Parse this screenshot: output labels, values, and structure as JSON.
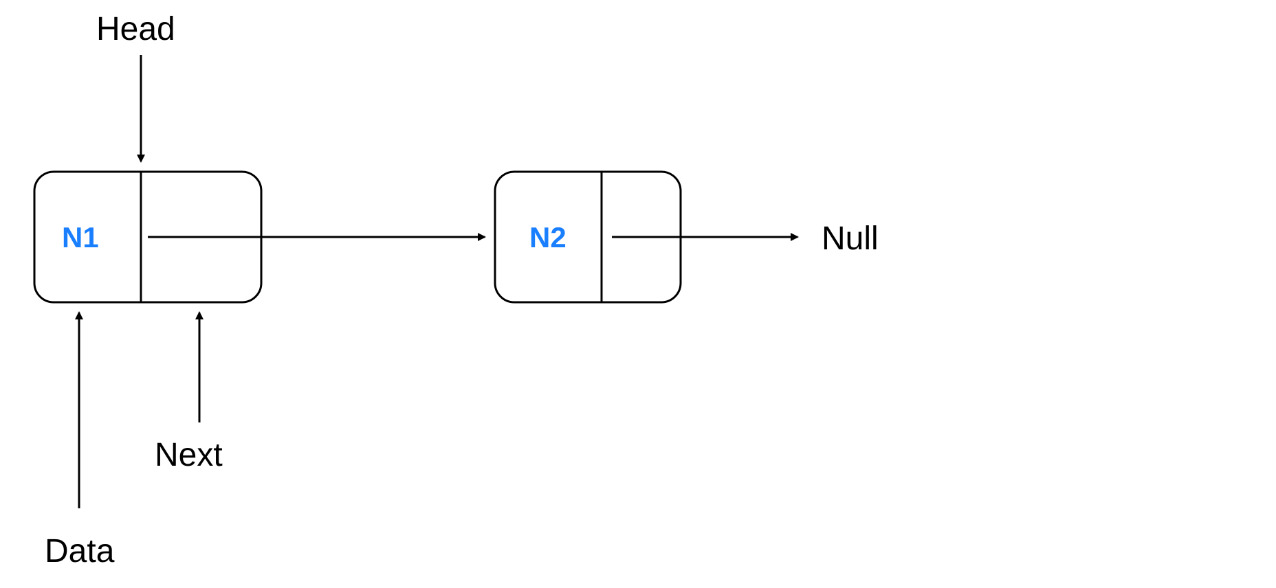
{
  "labels": {
    "head": "Head",
    "data": "Data",
    "next": "Next",
    "null": "Null"
  },
  "nodes": {
    "n1": "N1",
    "n2": "N2"
  },
  "diagram": {
    "type": "linked-list",
    "description": "Singly linked list with two nodes N1 and N2, N1 next points to N2, N2 next points to Null. Head points to N1. Data and Next labels annotate parts of node N1."
  }
}
